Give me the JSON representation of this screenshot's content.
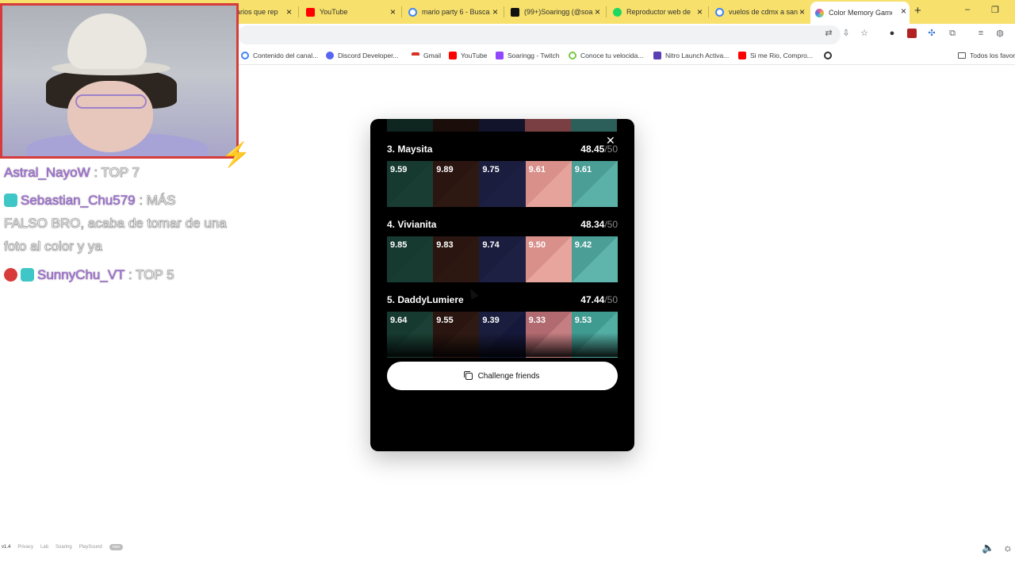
{
  "browser": {
    "tabs": [
      {
        "label": "arios que rep",
        "icon": "document-icon",
        "color": "#f7e06b"
      },
      {
        "label": "YouTube",
        "icon": "youtube-icon",
        "color": "#ff0000"
      },
      {
        "label": "mario party 6 - Busca",
        "icon": "google-icon",
        "color": "#4285f4"
      },
      {
        "label": "(99+)Soaringg (@soa",
        "icon": "tiktok-icon",
        "color": "#111111"
      },
      {
        "label": "Reproductor web de",
        "icon": "spotify-icon",
        "color": "#1ed760"
      },
      {
        "label": "vuelos de cdmx a san",
        "icon": "google-icon",
        "color": "#4285f4"
      },
      {
        "label": "Color Memory Game",
        "icon": "color-wheel-icon",
        "color": "#e05a9a",
        "active": true
      }
    ],
    "new_tab_label": "+",
    "window_controls": {
      "minimize": "–",
      "restore": "❐"
    },
    "bookmarks": [
      {
        "label": "Contenido del canal...",
        "icon": "google-icon",
        "color": "#4285f4"
      },
      {
        "label": "Discord Developer...",
        "icon": "discord-icon",
        "color": "#5865f2"
      },
      {
        "label": "Gmail",
        "icon": "gmail-icon",
        "color": "#d93025"
      },
      {
        "label": "YouTube",
        "icon": "youtube-icon",
        "color": "#ff0000"
      },
      {
        "label": "Soaringg - Twitch",
        "icon": "twitch-icon",
        "color": "#9146ff"
      },
      {
        "label": "Conoce tu velocida...",
        "icon": "speedtest-icon",
        "color": "#7ac943"
      },
      {
        "label": "Nitro Launch Activa...",
        "icon": "nitro-icon",
        "color": "#5b3fb5"
      },
      {
        "label": "Si me Rio, Compro...",
        "icon": "youtube-icon",
        "color": "#ff0000"
      },
      {
        "label": "",
        "icon": "globe-icon",
        "color": "#333333"
      }
    ],
    "all_bookmarks_label": "Todos los favor"
  },
  "chat": [
    {
      "user": "Astral_NayoW",
      "message": " : TOP 7",
      "badges": []
    },
    {
      "user": "Sebastian_Chu579",
      "message": " : MÁS",
      "badges": [
        "#3fc6c6"
      ]
    },
    {
      "continuation": "FALSO BRO, acaba de tomar de una"
    },
    {
      "continuation": "foto al color y ya"
    },
    {
      "user": "SunnyChu_VT",
      "message": " : TOP 5",
      "badges": [
        "#d83b3b",
        "#3fc6c6"
      ]
    }
  ],
  "leaderboard": {
    "entries": [
      {
        "rank_name": "3. Maysita",
        "score": "48.45",
        "max": "/50",
        "colors": [
          {
            "value": "9.59",
            "bg": "#163a30",
            "guess": "#1a3d33"
          },
          {
            "value": "9.89",
            "bg": "#2a1510",
            "guess": "#2d1812"
          },
          {
            "value": "9.75",
            "bg": "#1a1d3d",
            "guess": "#1c1f42"
          },
          {
            "value": "9.61",
            "bg": "#d98f8a",
            "guess": "#e5a39b"
          },
          {
            "value": "9.61",
            "bg": "#4a9e96",
            "guess": "#5bb0a8"
          }
        ]
      },
      {
        "rank_name": "4. Vivianita",
        "score": "48.34",
        "max": "/50",
        "colors": [
          {
            "value": "9.85",
            "bg": "#163a30",
            "guess": "#183c32"
          },
          {
            "value": "9.83",
            "bg": "#2a1510",
            "guess": "#2c1711"
          },
          {
            "value": "9.74",
            "bg": "#1a1d3d",
            "guess": "#1d2043"
          },
          {
            "value": "9.50",
            "bg": "#d98f8a",
            "guess": "#e7a59d"
          },
          {
            "value": "9.42",
            "bg": "#4a9e96",
            "guess": "#5fb4ac"
          }
        ]
      },
      {
        "rank_name": "5. DaddyLumiere",
        "score": "47.44",
        "max": "/50",
        "colors": [
          {
            "value": "9.64",
            "bg": "#163a30",
            "guess": "#1b4035"
          },
          {
            "value": "9.55",
            "bg": "#2a1510",
            "guess": "#2f1a13"
          },
          {
            "value": "9.39",
            "bg": "#1a1d3d",
            "guess": "#15183a"
          },
          {
            "value": "9.33",
            "bg": "#b06a70",
            "guess": "#c57e82"
          },
          {
            "value": "9.53",
            "bg": "#3f9a90",
            "guess": "#52ada3"
          }
        ]
      }
    ],
    "close_label": "✕",
    "challenge_label": "Challenge friends"
  },
  "footer": {
    "version": "v1.4",
    "links": [
      "Privacy",
      "Lab",
      "Soaring",
      "PlaySound"
    ],
    "badge": "new"
  },
  "theme": {
    "accent": "#f7e06b",
    "webcam_border": "#d63a3a"
  }
}
